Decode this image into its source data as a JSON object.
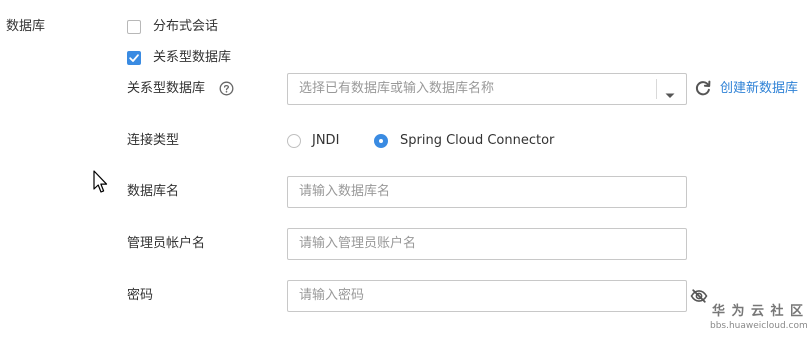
{
  "section": {
    "title": "数据库"
  },
  "options": {
    "distributed_session": {
      "label": "分布式会话",
      "checked": false
    },
    "relational_db": {
      "label": "关系型数据库",
      "checked": true
    }
  },
  "form": {
    "relational_db": {
      "label": "关系型数据库",
      "placeholder": "选择已有数据库或输入数据库名称",
      "create_link": "创建新数据库"
    },
    "connection_type": {
      "label": "连接类型",
      "options": [
        {
          "label": "JNDI",
          "selected": false
        },
        {
          "label": "Spring Cloud Connector",
          "selected": true
        }
      ]
    },
    "db_name": {
      "label": "数据库名",
      "placeholder": "请输入数据库名"
    },
    "admin_account": {
      "label": "管理员帐户名",
      "placeholder": "请输入管理员账户名"
    },
    "password": {
      "label": "密码",
      "placeholder": "请输入密码"
    }
  },
  "watermark": {
    "title": "华 为 云 社 区",
    "url": "bbs.huaweicloud.com"
  },
  "colors": {
    "accent": "#3a8be2",
    "link": "#2f82d6",
    "border": "#c8c8c8",
    "placeholder": "#999999"
  }
}
